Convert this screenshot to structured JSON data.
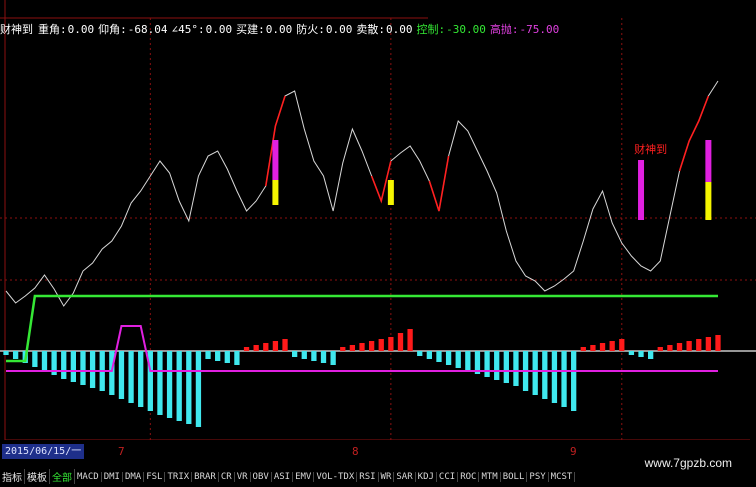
{
  "header": {
    "items": [
      {
        "label": "财神到",
        "value": "",
        "color": "#ffffff"
      },
      {
        "label": "重角:",
        "value": "0.00",
        "color": "#ffffff"
      },
      {
        "label": "仰角:",
        "value": "-68.04",
        "color": "#ffffff"
      },
      {
        "label": "∠45°:",
        "value": "0.00",
        "color": "#ffffff"
      },
      {
        "label": "买建:",
        "value": "0.00",
        "color": "#ffffff"
      },
      {
        "label": "防火:",
        "value": "0.00",
        "color": "#ffffff"
      },
      {
        "label": "卖散:",
        "value": "0.00",
        "color": "#ffffff"
      },
      {
        "label": "控制:",
        "value": "-30.00",
        "color": "#34e834"
      },
      {
        "label": "高抛:",
        "value": "-75.00",
        "color": "#e040e0"
      }
    ]
  },
  "chart_data": {
    "type": "line",
    "annotation": "财神到",
    "colors": {
      "white": "#d8d8d8",
      "red": "#ff2020",
      "green": "#35e835",
      "magenta": "#e020e0",
      "yellow": "#f5f500",
      "cyan": "#40e8ee",
      "bar_red": "#ff1a1a"
    },
    "x": [
      0,
      1,
      2,
      3,
      4,
      5,
      6,
      7,
      8,
      9,
      10,
      11,
      12,
      13,
      14,
      15,
      16,
      17,
      18,
      19,
      20,
      21,
      22,
      23,
      24,
      25,
      26,
      27,
      28,
      29,
      30,
      31,
      32,
      33,
      34,
      35,
      36,
      37,
      38,
      39,
      40,
      41,
      42,
      43,
      44,
      45,
      46,
      47,
      48,
      49,
      50,
      51,
      52,
      53,
      54,
      55,
      56,
      57,
      58,
      59,
      60,
      61,
      62,
      63,
      64,
      65,
      66,
      67,
      68,
      69,
      70,
      71,
      72,
      73,
      74
    ],
    "white_line": [
      60,
      48,
      55,
      63,
      76,
      62,
      45,
      58,
      80,
      88,
      102,
      110,
      125,
      148,
      160,
      175,
      190,
      178,
      150,
      130,
      175,
      195,
      200,
      182,
      160,
      140,
      150,
      165,
      225,
      255,
      260,
      222,
      190,
      175,
      140,
      188,
      222,
      200,
      175,
      150,
      190,
      198,
      205,
      190,
      170,
      140,
      195,
      230,
      220,
      200,
      180,
      158,
      120,
      90,
      75,
      70,
      60,
      65,
      72,
      80,
      110,
      142,
      160,
      128,
      108,
      95,
      85,
      80,
      90,
      135,
      180,
      210,
      230,
      255,
      270
    ],
    "green_line": [
      -10,
      -10,
      -10,
      55,
      55,
      55,
      55,
      55,
      55,
      55,
      55,
      55,
      55,
      55,
      55,
      55,
      55,
      55,
      55,
      55,
      55,
      55,
      55,
      55,
      55,
      55,
      55,
      55,
      55,
      55,
      55,
      55,
      55,
      55,
      55,
      55,
      55,
      55,
      55,
      55,
      55,
      55,
      55,
      55,
      55,
      55,
      55,
      55,
      55,
      55,
      55,
      55,
      55,
      55,
      55,
      55,
      55,
      55,
      55,
      55,
      55,
      55,
      55,
      55,
      55,
      55,
      55,
      55,
      55,
      55,
      55,
      55,
      55,
      55,
      55
    ],
    "magenta_line": [
      -20,
      -20,
      -20,
      -20,
      -20,
      -20,
      -20,
      -20,
      -20,
      -20,
      -20,
      -20,
      25,
      25,
      25,
      -20,
      -20,
      -20,
      -20,
      -20,
      -20,
      -20,
      -20,
      -20,
      -20,
      -20,
      -20,
      -20,
      -20,
      -20,
      -20,
      -20,
      -20,
      -20,
      -20,
      -20,
      -20,
      -20,
      -20,
      -20,
      -20,
      -20,
      -20,
      -20,
      -20,
      -20,
      -20,
      -20,
      -20,
      -20,
      -20,
      -20,
      -20,
      -20,
      -20,
      -20,
      -20,
      -20,
      -20,
      -20,
      -20,
      -20,
      -20,
      -20,
      -20,
      -20,
      -20,
      -20,
      -20,
      -20,
      -20,
      -20,
      -20,
      -20,
      -20
    ],
    "histogram": [
      -4,
      -8,
      -12,
      -16,
      -20,
      -24,
      -28,
      -31,
      -34,
      -37,
      -40,
      -44,
      -48,
      -52,
      -56,
      -60,
      -64,
      -67,
      -70,
      -73,
      -76,
      -8,
      -10,
      -12,
      -14,
      4,
      6,
      8,
      10,
      12,
      -6,
      -8,
      -10,
      -12,
      -14,
      4,
      6,
      8,
      10,
      12,
      14,
      18,
      22,
      -5,
      -8,
      -11,
      -14,
      -17,
      -20,
      -23,
      -26,
      -29,
      -32,
      -35,
      -40,
      -44,
      -48,
      -52,
      -56,
      -60,
      4,
      6,
      8,
      10,
      12,
      -4,
      -6,
      -8,
      4,
      6,
      8,
      10,
      12,
      14,
      16
    ],
    "months": [
      {
        "label": "7",
        "index": 15
      },
      {
        "label": "8",
        "index": 40
      },
      {
        "label": "9",
        "index": 64
      }
    ]
  },
  "date_box": "2015/06/15/一",
  "month_labels": [
    "7",
    "8",
    "9"
  ],
  "tabs": {
    "main": [
      "指标",
      "模板",
      "全部"
    ],
    "indicators": [
      "MACD",
      "DMI",
      "DMA",
      "FSL",
      "TRIX",
      "BRAR",
      "CR",
      "VR",
      "OBV",
      "ASI",
      "EMV",
      "VOL-TDX",
      "RSI",
      "WR",
      "SAR",
      "KDJ",
      "CCI",
      "ROC",
      "MTM",
      "BOLL",
      "PSY",
      "MCST"
    ]
  },
  "watermark": "www.7gpzb.com"
}
